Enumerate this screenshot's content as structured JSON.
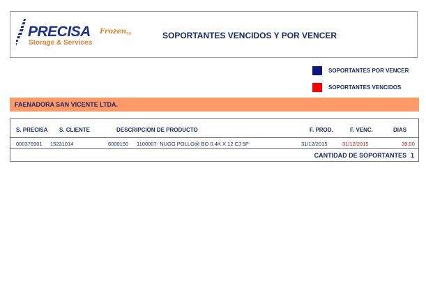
{
  "header": {
    "logo": {
      "main": "PRECISA",
      "frozen": "Frozen",
      "tm": "SM",
      "sub": "Storage & Services"
    },
    "title": "SOPORTANTES VENCIDOS Y POR VENCER"
  },
  "legend": [
    {
      "label": "SOPORTANTES POR VENCER",
      "color": "#0c1a80"
    },
    {
      "label": "SOPORTANTES VENCIDOS",
      "color": "#ff0000"
    }
  ],
  "company": {
    "name": "FAENADORA SAN VICENTE LTDA."
  },
  "table": {
    "columns": {
      "s_precisa": "S. PRECISA",
      "s_cliente": "S. CLIENTE",
      "descripcion": "DESCRIPCION DE PRODUCTO",
      "f_prod": "F. PROD.",
      "f_venc": "F. VENC.",
      "dias": "DIAS"
    },
    "rows": [
      {
        "s_precisa": "000376901",
        "s_cliente": "15231014",
        "codigo": "6000150",
        "descripcion": "1100007- NUGG POLLO@ BO 0.4K X 12 CJ 5P",
        "f_prod": "31/12/2015",
        "f_venc": "31/12/2015",
        "dias": "39,00"
      }
    ],
    "total_label": "CANTIDAD DE SOPORTANTES",
    "total_value": "1"
  },
  "colors": {
    "navy_text": "#1a2a6c",
    "company_bar": "#ff9966",
    "expired": "#cc1111"
  }
}
